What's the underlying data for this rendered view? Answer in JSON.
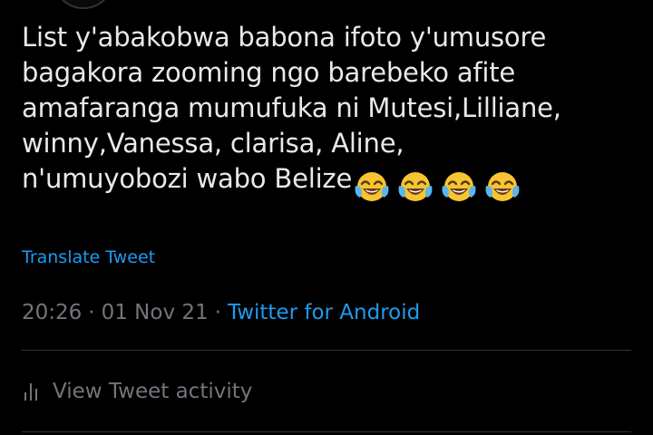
{
  "tweet": {
    "text_lines": [
      "List y'abakobwa babona ifoto y'umusore",
      "bagakora zooming ngo barebeko afite",
      "amafaranga mumufuka ni Mutesi,Lilliane,",
      "winny,Vanessa, clarisa, Aline,",
      "n'umuyobozi wabo Belize"
    ],
    "emoji": [
      "face-with-tears-of-joy-icon",
      "face-with-tears-of-joy-icon",
      "face-with-tears-of-joy-icon",
      "face-with-tears-of-joy-icon"
    ],
    "translate_label": "Translate Tweet",
    "time": "20:26",
    "date": "01 Nov 21",
    "separator": "·",
    "source": "Twitter for Android"
  },
  "activity": {
    "label": "View Tweet activity",
    "icon": "bar-chart-icon"
  },
  "colors": {
    "background": "#000000",
    "text": "#e7e9ea",
    "secondary": "#71767b",
    "link": "#1d9bf0",
    "divider": "#2f3336"
  }
}
